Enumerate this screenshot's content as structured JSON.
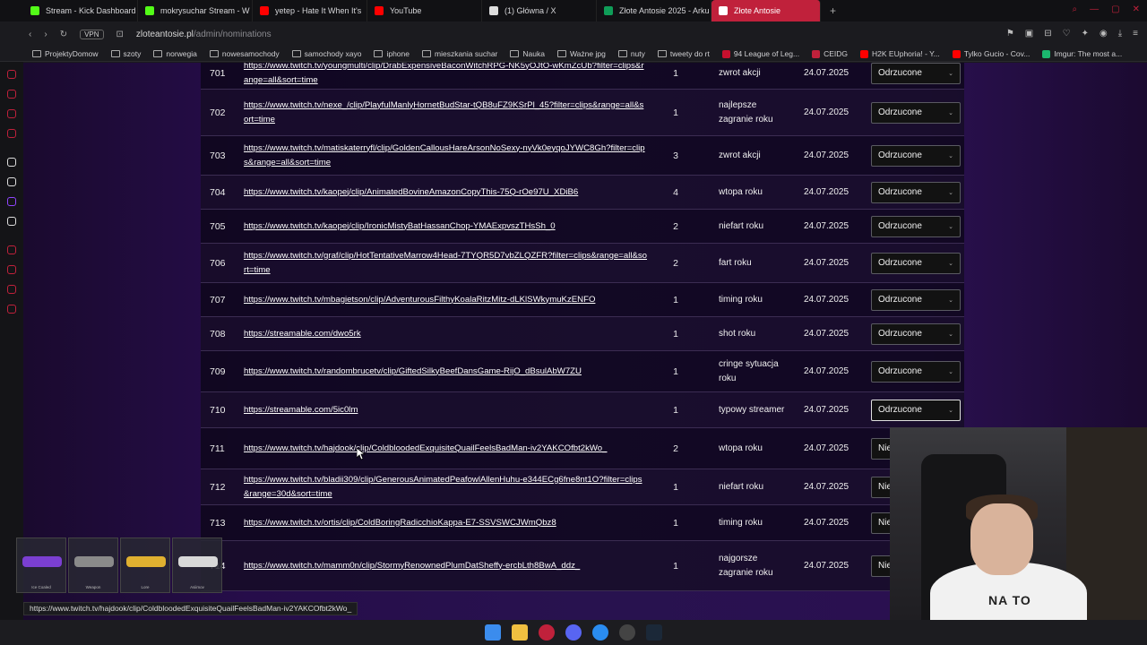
{
  "tabs": [
    {
      "title": "Stream - Kick Dashboard",
      "color": "#53fc18"
    },
    {
      "title": "mokrysuchar Stream - W",
      "color": "#53fc18"
    },
    {
      "title": "yetep - Hate It When It's",
      "color": "#ff0000"
    },
    {
      "title": "YouTube",
      "color": "#ff0000"
    },
    {
      "title": "(1) Główna / X",
      "color": "#ffffff"
    },
    {
      "title": "Złote Antosie 2025 - Arku",
      "color": "#0f9d58"
    },
    {
      "title": "Złote Antosie",
      "color": "#ffffff"
    }
  ],
  "address": {
    "vpn": "VPN",
    "host": "zloteantosie.pl",
    "path": "/admin/nominations"
  },
  "bookmarks": [
    "ProjektyDomow",
    "szoty",
    "norwegia",
    "nowesamochody",
    "samochody xayo",
    "iphone",
    "mieszkania suchar",
    "Nauka",
    "Ważne jpg",
    "nuty",
    "tweety do rt",
    "94 League of Leg...",
    "CEIDG",
    "H2K EUphoria! - Y...",
    "Tylko Gucio - Cov...",
    "Imgur: The most a..."
  ],
  "rows": [
    {
      "id": "701",
      "url": "https://www.twitch.tv/youngmulti/clip/DrabExpensiveBaconWitchRPG-NK5yOJtO-wKmZcUb?filter=clips&range=all&sort=time",
      "votes": "1",
      "category": "zwrot akcji",
      "date": "24.07.2025",
      "status": "Odrzucone"
    },
    {
      "id": "702",
      "url": "https://www.twitch.tv/nexe_/clip/PlayfulManlyHornetBudStar-tQB8uFZ9KSrPl_45?filter=clips&range=all&sort=time",
      "votes": "1",
      "category": "najlepsze zagranie roku",
      "date": "24.07.2025",
      "status": "Odrzucone"
    },
    {
      "id": "703",
      "url": "https://www.twitch.tv/matiskaterryfl/clip/GoldenCallousHareArsonNoSexy-nyVk0eyqoJYWC8Gh?filter=clips&range=all&sort=time",
      "votes": "3",
      "category": "zwrot akcji",
      "date": "24.07.2025",
      "status": "Odrzucone"
    },
    {
      "id": "704",
      "url": "https://www.twitch.tv/kaopej/clip/AnimatedBovineAmazonCopyThis-75Q-rOe97U_XDiB6",
      "votes": "4",
      "category": "wtopa roku",
      "date": "24.07.2025",
      "status": "Odrzucone"
    },
    {
      "id": "705",
      "url": "https://www.twitch.tv/kaopej/clip/IronicMistyBatHassanChop-YMAExpvszTHsSh_0",
      "votes": "2",
      "category": "niefart roku",
      "date": "24.07.2025",
      "status": "Odrzucone"
    },
    {
      "id": "706",
      "url": "https://www.twitch.tv/graf/clip/HotTentativeMarrow4Head-7TYQR5D7vbZLQZFR?filter=clips&range=all&sort=time",
      "votes": "2",
      "category": "fart roku",
      "date": "24.07.2025",
      "status": "Odrzucone"
    },
    {
      "id": "707",
      "url": "https://www.twitch.tv/mbagietson/clip/AdventurousFilthyKoalaRitzMitz-dLKlSWkymuKzENFO",
      "votes": "1",
      "category": "timing roku",
      "date": "24.07.2025",
      "status": "Odrzucone"
    },
    {
      "id": "708",
      "url": "https://streamable.com/dwo5rk",
      "votes": "1",
      "category": "shot roku",
      "date": "24.07.2025",
      "status": "Odrzucone"
    },
    {
      "id": "709",
      "url": "https://www.twitch.tv/randombrucetv/clip/GiftedSilkyBeefDansGame-RijO_dBsulAbW7ZU",
      "votes": "1",
      "category": "cringe sytuacja roku",
      "date": "24.07.2025",
      "status": "Odrzucone"
    },
    {
      "id": "710",
      "url": "https://streamable.com/5ic0lm",
      "votes": "1",
      "category": "typowy streamer",
      "date": "24.07.2025",
      "status": "Odrzucone"
    },
    {
      "id": "711",
      "url": "https://www.twitch.tv/hajdook/clip/ColdbloodedExquisiteQuailFeelsBadMan-iv2YAKCOfbt2kWo_",
      "votes": "2",
      "category": "wtopa roku",
      "date": "24.07.2025",
      "status": "Nies"
    },
    {
      "id": "712",
      "url": "https://www.twitch.tv/bladii309/clip/GenerousAnimatedPeafowlAllenHuhu-e344ECg6fne8nt1O?filter=clips&range=30d&sort=time",
      "votes": "1",
      "category": "niefart roku",
      "date": "24.07.2025",
      "status": "Nies"
    },
    {
      "id": "713",
      "url": "https://www.twitch.tv/ortis/clip/ColdBoringRadicchioKappa-E7-SSVSWCJWmQbz8",
      "votes": "1",
      "category": "timing roku",
      "date": "24.07.2025",
      "status": "Nies"
    },
    {
      "id": "714",
      "url": "https://www.twitch.tv/mamm0n/clip/StormyRenownedPlumDatSheffy-ercbLth8BwA_ddz_",
      "votes": "1",
      "category": "najgorsze zagranie roku",
      "date": "24.07.2025",
      "status": "Nies"
    }
  ],
  "statusbar": "https://www.twitch.tv/hajdook/clip/ColdbloodedExquisiteQuailFeelsBadMan-iv2YAKCOfbt2kWo_",
  "skins": [
    "Ice Coaled",
    "Weapon",
    "Lore",
    "Asiimov"
  ],
  "cam_print": "NA TO"
}
